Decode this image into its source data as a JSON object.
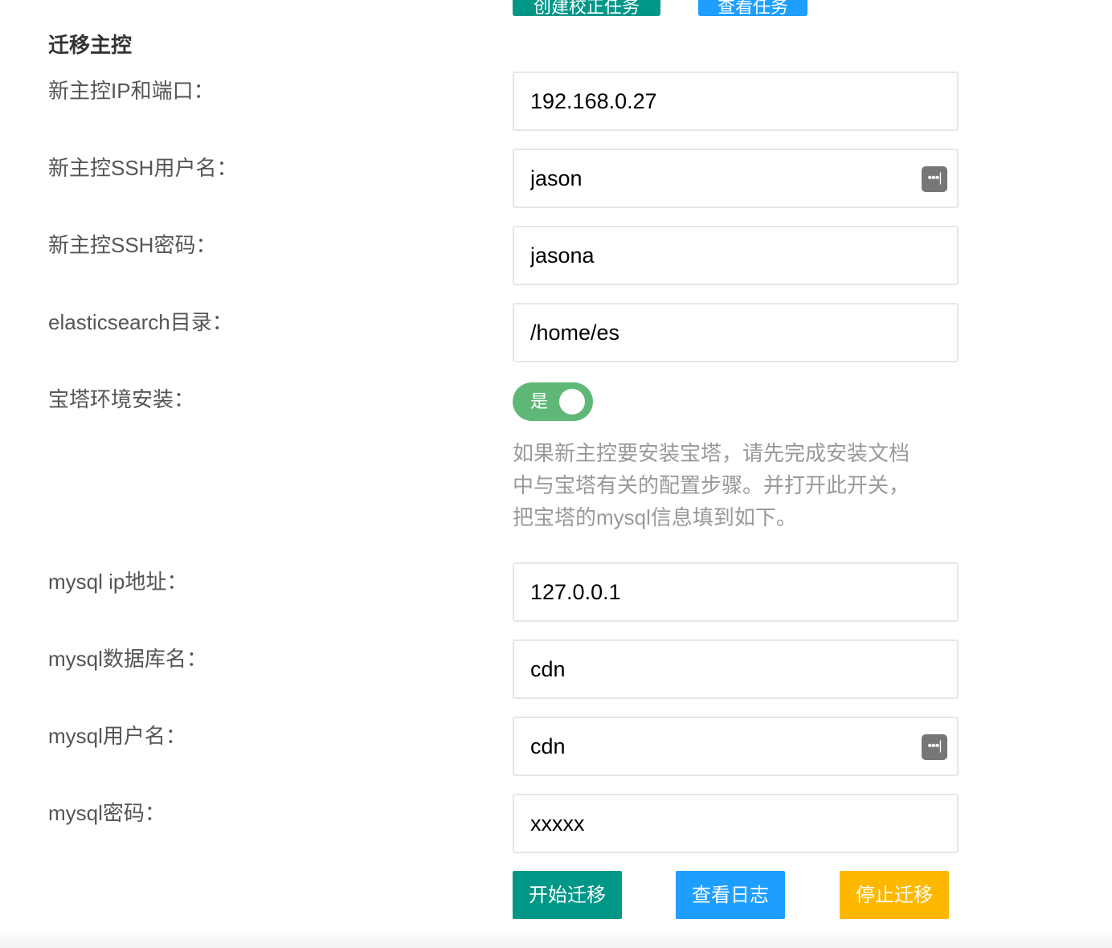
{
  "top_buttons": {
    "create_task": "创建校正任务",
    "view_task": "查看任务"
  },
  "section_title": "迁移主控",
  "form": {
    "master_ip": {
      "label": "新主控IP和端口：",
      "value": "192.168.0.27"
    },
    "ssh_user": {
      "label": "新主控SSH用户名：",
      "value": "jason",
      "icon": "password-manager-icon"
    },
    "ssh_password": {
      "label": "新主控SSH密码：",
      "value": "jasona"
    },
    "es_dir": {
      "label": "elasticsearch目录：",
      "value": "/home/es"
    },
    "bt_install": {
      "label": "宝塔环境安装：",
      "switch_text": "是",
      "checked": true,
      "switch_color": "#5FB878"
    },
    "hint_lines": [
      "如果新主控要安装宝塔，请先完成安装文档",
      "中与宝塔有关的配置步骤。并打开此开关，",
      "把宝塔的mysql信息填到如下。"
    ],
    "mysql_ip": {
      "label": "mysql ip地址：",
      "value": "127.0.0.1"
    },
    "mysql_db": {
      "label": "mysql数据库名：",
      "value": "cdn"
    },
    "mysql_user": {
      "label": "mysql用户名：",
      "value": "cdn",
      "icon": "password-manager-icon"
    },
    "mysql_password": {
      "label": "mysql密码：",
      "value": "xxxxx"
    }
  },
  "actions": {
    "start": "开始迁移",
    "view_log": "查看日志",
    "stop": "停止迁移"
  },
  "colors": {
    "green": "#009688",
    "blue": "#1E9FFF",
    "orange": "#FFB800"
  }
}
